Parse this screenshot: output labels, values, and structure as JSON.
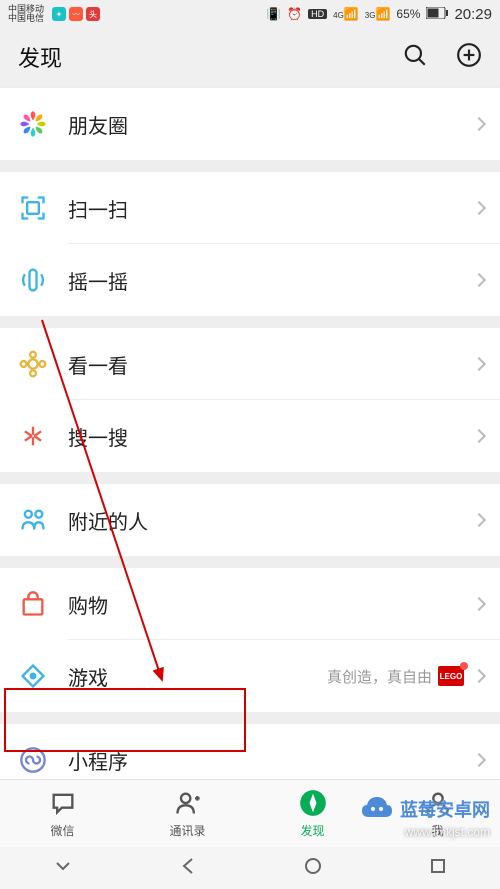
{
  "status": {
    "carrier1": "中国移动",
    "carrier2": "中国电信",
    "hd": "HD",
    "net1": "4G",
    "net2": "3G",
    "battery": "65%",
    "time": "20:29"
  },
  "header": {
    "title": "发现"
  },
  "groups": [
    {
      "items": [
        {
          "key": "moments",
          "label": "朋友圈"
        }
      ]
    },
    {
      "items": [
        {
          "key": "scan",
          "label": "扫一扫"
        },
        {
          "key": "shake",
          "label": "摇一摇"
        }
      ]
    },
    {
      "items": [
        {
          "key": "topstories",
          "label": "看一看"
        },
        {
          "key": "search",
          "label": "搜一搜"
        }
      ]
    },
    {
      "items": [
        {
          "key": "nearby",
          "label": "附近的人"
        }
      ]
    },
    {
      "items": [
        {
          "key": "shopping",
          "label": "购物"
        },
        {
          "key": "games",
          "label": "游戏",
          "extra": "真创造，真自由",
          "badge": "LEGO"
        }
      ]
    },
    {
      "items": [
        {
          "key": "miniprogram",
          "label": "小程序"
        }
      ]
    }
  ],
  "tabs": [
    {
      "key": "chats",
      "label": "微信"
    },
    {
      "key": "contacts",
      "label": "通讯录"
    },
    {
      "key": "discover",
      "label": "发现",
      "active": true
    },
    {
      "key": "me",
      "label": "我"
    }
  ],
  "watermark": {
    "brand": "蓝莓安卓网",
    "url": "www.lmkjst.com"
  },
  "icons": {
    "moments": "moments",
    "scan": "scan",
    "shake": "shake",
    "topstories": "topstories",
    "search": "search-spark",
    "nearby": "nearby",
    "shopping": "shopping",
    "games": "games",
    "miniprogram": "miniprogram"
  }
}
